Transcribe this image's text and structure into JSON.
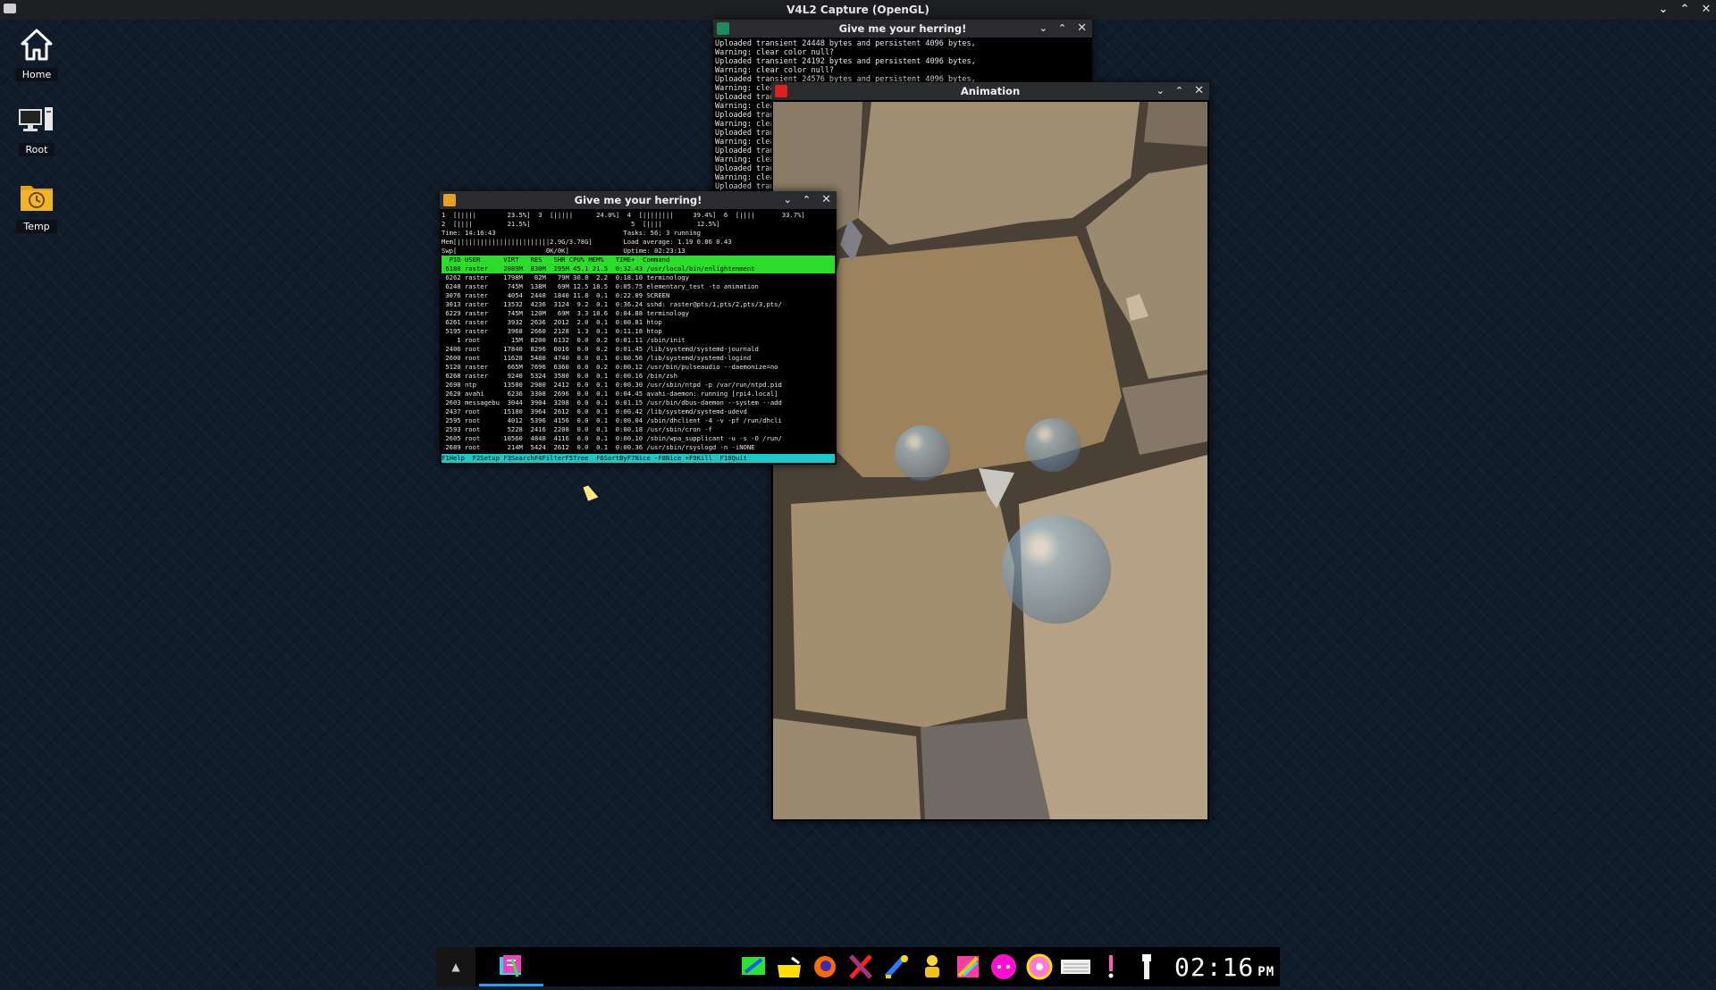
{
  "topbar": {
    "title": "V4L2 Capture (OpenGL)"
  },
  "desktop_icons": [
    {
      "label": "Home"
    },
    {
      "label": "Root"
    },
    {
      "label": "Temp"
    }
  ],
  "log_window": {
    "title": "Give me your herring!",
    "lines": [
      "Uploaded transient 24448 bytes and persistent 4096 bytes,",
      "Warning: clear color null?",
      "Uploaded transient 24192 bytes and persistent 4096 bytes,",
      "Warning: clear color null?",
      "Uploaded transient 24576 bytes and persistent 4096 bytes,",
      "Warning: clea",
      "Uploaded tran",
      "Warning: clea",
      "Uploaded tran",
      "Warning: clea",
      "Uploaded tran",
      "Warning: clea",
      "Uploaded tran",
      "Warning: clea",
      "Uploaded tran",
      "Warning: clea",
      "Uploaded tran"
    ]
  },
  "htop_window": {
    "title": "Give me your herring!",
    "meters": [
      "1  [|||||        23.5%]  3  [|||||      24.0%]  4  [||||||||     39.4%]  6  [||||       33.7%]",
      "2  [||||         21.5%]                          5  [||||         12.5%]",
      "Time: 14:16:43                                 Tasks: 56; 3 running",
      "Mem[||||||||||||||||||||||||2.9G/3.78G]        Load average: 1.19 0.86 0.43",
      "Swp[                       0K/0K]              Uptime: 02:23:13"
    ],
    "columns": "  PID USER      VIRT   RES   SHR CPU% MEM%   TIME+  Command",
    "selected_row": " 6180 raster    2089M  830M  195M 45.1 21.5  0:32.43 /usr/local/bin/enlightenment",
    "rows": [
      " 6262 raster    1798M   82M   79M 30.8  2.2  0:18.10 terminology",
      " 6248 raster     745M  138M   69M 12.5 18.5  0:05.75 elementary_test -to animation",
      " 3076 raster     4054  2448  1840 11.8  0.1  0:22.09 SCREEN",
      " 3013 raster    13532  4236  3124  9.2  0.1  0:36.24 sshd: raster@pts/1,pts/2,pts/3,pts/",
      " 6229 raster     745M  120M   69M  3.3 18.6  0:04.88 terminology",
      " 6261 raster     3932  2636  2012  2.0  0.1  0:00.81 htop",
      " 5195 raster     3968  2660  2128  1.3  0.1  0:11.18 htop",
      "    1 root        15M  8200  6132  0.0  0.2  0:01.11 /sbin/init",
      " 2406 root      17840  8296  6016  0.0  0.2  0:01.45 /lib/systemd/systemd-journald",
      " 2600 root      11628  5480  4740  0.0  0.1  0:00.56 /lib/systemd/systemd-logind",
      " 5120 raster     665M  7696  6360  0.0  0.2  0:00.12 /usr/bin/pulseaudio --daemonize=no",
      " 6268 raster     9240  5324  3580  0.0  0.1  0:00.16 /bin/zsh",
      " 2698 ntp       13500  2980  2412  0.0  0.1  0:00.30 /usr/sbin/ntpd -p /var/run/ntpd.pid",
      " 2620 avahi      6236  3308  2696  0.0  0.1  0:04.45 avahi-daemon: running [rpi4.local]",
      " 2603 messagebu  3044  3904  3208  0.0  0.1  0:01.15 /usr/bin/dbus-daemon --system --add",
      " 2437 root      15180  3964  2612  0.0  0.1  0:00.42 /lib/systemd/systemd-udevd",
      " 2595 root       4012  5396  4156  0.0  0.1  0:00.04 /sbin/dhclient -4 -v -pf /run/dhcli",
      " 2593 root       5228  2416  2208  0.0  0.1  0:00.18 /usr/sbin/cron -f",
      " 2605 root      10560  4848  4116  0.0  0.1  0:00.10 /sbin/wpa_supplicant -u -s -O /run/",
      " 2689 root       214M  5424  2612  0.0  0.1  0:00.36 /usr/sbin/rsyslogd -n -iNONE"
    ],
    "footer": "F1Help  F2Setup F3SearchF4FilterF5Tree  F6SortByF7Nice -F8Nice +F9Kill  F10Quit"
  },
  "animation_window": {
    "title": "Animation"
  },
  "taskbar": {
    "expand_icon": "▲",
    "clock": {
      "time": "02:16",
      "ampm": "PM"
    }
  },
  "colors": {
    "htop_green": "#2bdc2b",
    "htop_cyan": "#1cc7c7",
    "accent": "#1aa3ff"
  }
}
